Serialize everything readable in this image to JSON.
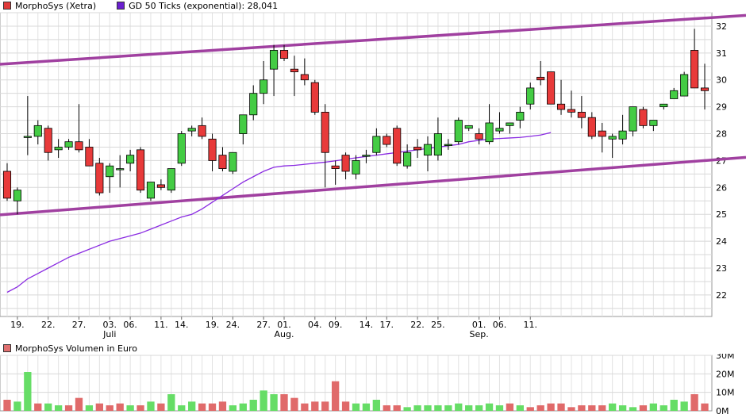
{
  "chart_data": [
    {
      "type": "candlestick",
      "legend": [
        {
          "label": "MorphoSys (Xetra)",
          "color": "#e03a3a"
        },
        {
          "label": "GD 50 Ticks (exponential): 28,041",
          "color": "#6a1fd0"
        }
      ],
      "yticks": [
        22,
        23,
        24,
        25,
        26,
        27,
        28,
        29,
        30,
        31,
        32
      ],
      "ylim": [
        21.2,
        32.5
      ],
      "x_ticks": [
        {
          "i": 1,
          "label": "19."
        },
        {
          "i": 4,
          "label": "22."
        },
        {
          "i": 7,
          "label": "27."
        },
        {
          "i": 10,
          "label": "03.",
          "sub": "Juli"
        },
        {
          "i": 12,
          "label": "06."
        },
        {
          "i": 15,
          "label": "11."
        },
        {
          "i": 17,
          "label": "14."
        },
        {
          "i": 20,
          "label": "19."
        },
        {
          "i": 22,
          "label": "24."
        },
        {
          "i": 25,
          "label": "27."
        },
        {
          "i": 27,
          "label": "01.",
          "sub": "Aug."
        },
        {
          "i": 30,
          "label": "04."
        },
        {
          "i": 32,
          "label": "09."
        },
        {
          "i": 35,
          "label": "14."
        },
        {
          "i": 37,
          "label": "17."
        },
        {
          "i": 40,
          "label": "22."
        },
        {
          "i": 42,
          "label": "25."
        },
        {
          "i": 46,
          "label": "01.",
          "sub": "Sep."
        },
        {
          "i": 48,
          "label": "06."
        },
        {
          "i": 51,
          "label": "11."
        }
      ],
      "ohlc": [
        [
          26.6,
          26.9,
          25.5,
          25.6
        ],
        [
          25.5,
          26.0,
          25.0,
          25.9
        ],
        [
          27.9,
          29.4,
          27.2,
          27.9
        ],
        [
          27.9,
          28.5,
          27.6,
          28.3
        ],
        [
          28.2,
          28.3,
          27.0,
          27.3
        ],
        [
          27.4,
          27.8,
          27.1,
          27.5
        ],
        [
          27.5,
          27.8,
          27.4,
          27.7
        ],
        [
          27.7,
          29.1,
          27.3,
          27.4
        ],
        [
          27.5,
          27.8,
          26.8,
          26.8
        ],
        [
          26.9,
          27.1,
          25.7,
          25.8
        ],
        [
          26.4,
          26.9,
          25.8,
          26.8
        ],
        [
          26.7,
          27.2,
          26.0,
          26.7
        ],
        [
          26.9,
          27.4,
          26.6,
          27.2
        ],
        [
          27.4,
          27.5,
          25.8,
          25.9
        ],
        [
          25.6,
          26.2,
          25.5,
          26.2
        ],
        [
          26.1,
          26.3,
          25.9,
          26.0
        ],
        [
          25.9,
          26.7,
          25.8,
          26.7
        ],
        [
          26.9,
          28.1,
          26.8,
          28.0
        ],
        [
          28.1,
          28.3,
          27.9,
          28.2
        ],
        [
          28.3,
          28.6,
          27.8,
          27.9
        ],
        [
          27.8,
          28.0,
          26.6,
          27.0
        ],
        [
          27.2,
          27.5,
          26.6,
          26.7
        ],
        [
          26.6,
          27.3,
          26.5,
          27.3
        ],
        [
          28.0,
          28.7,
          27.6,
          28.7
        ],
        [
          28.7,
          29.8,
          28.5,
          29.5
        ],
        [
          29.5,
          30.7,
          29.1,
          30.0
        ],
        [
          30.4,
          31.3,
          29.4,
          31.1
        ],
        [
          31.1,
          31.3,
          30.7,
          30.8
        ],
        [
          30.4,
          30.9,
          29.4,
          30.3
        ],
        [
          30.2,
          30.8,
          29.8,
          30.0
        ],
        [
          29.9,
          30.0,
          28.7,
          28.8
        ],
        [
          28.8,
          29.1,
          26.0,
          27.3
        ],
        [
          26.8,
          27.0,
          26.1,
          26.7
        ],
        [
          27.2,
          27.3,
          26.3,
          26.6
        ],
        [
          26.5,
          27.2,
          26.3,
          27.0
        ],
        [
          27.2,
          27.4,
          26.9,
          27.2
        ],
        [
          27.3,
          28.2,
          27.2,
          27.9
        ],
        [
          27.9,
          28.0,
          27.5,
          27.6
        ],
        [
          28.2,
          28.3,
          26.8,
          26.9
        ],
        [
          26.8,
          27.6,
          26.7,
          27.3
        ],
        [
          27.5,
          27.8,
          27.1,
          27.4
        ],
        [
          27.2,
          27.9,
          26.6,
          27.6
        ],
        [
          27.2,
          28.6,
          27.0,
          28.0
        ],
        [
          27.6,
          27.8,
          27.4,
          27.6
        ],
        [
          27.7,
          28.6,
          27.6,
          28.5
        ],
        [
          28.2,
          28.3,
          28.1,
          28.3
        ],
        [
          28.0,
          28.2,
          27.6,
          27.8
        ],
        [
          27.7,
          29.1,
          27.6,
          28.4
        ],
        [
          28.1,
          28.8,
          28.0,
          28.2
        ],
        [
          28.3,
          28.4,
          28.0,
          28.4
        ],
        [
          28.5,
          29.0,
          28.2,
          28.8
        ],
        [
          29.1,
          29.9,
          28.9,
          29.7
        ],
        [
          30.1,
          30.7,
          29.8,
          30.0
        ],
        [
          30.3,
          30.3,
          29.1,
          29.1
        ],
        [
          29.1,
          30.0,
          28.7,
          28.9
        ],
        [
          28.9,
          29.6,
          28.6,
          28.8
        ],
        [
          28.8,
          29.4,
          28.2,
          28.6
        ],
        [
          28.6,
          28.8,
          27.8,
          27.9
        ],
        [
          28.1,
          28.4,
          27.3,
          27.9
        ],
        [
          27.8,
          28.0,
          27.1,
          27.9
        ],
        [
          27.8,
          28.7,
          27.6,
          28.1
        ],
        [
          28.1,
          29.0,
          27.9,
          29.0
        ],
        [
          28.9,
          29.0,
          28.2,
          28.3
        ],
        [
          28.3,
          28.5,
          28.1,
          28.5
        ],
        [
          29.0,
          29.1,
          28.9,
          29.1
        ],
        [
          29.3,
          29.7,
          29.3,
          29.6
        ],
        [
          29.4,
          30.3,
          29.4,
          30.2
        ],
        [
          31.1,
          31.9,
          29.7,
          29.7
        ],
        [
          29.7,
          30.6,
          28.9,
          29.6
        ]
      ],
      "gd50": [
        22.1,
        22.3,
        22.6,
        22.8,
        23.0,
        23.2,
        23.4,
        23.55,
        23.7,
        23.85,
        24.0,
        24.1,
        24.2,
        24.3,
        24.45,
        24.6,
        24.75,
        24.9,
        25.0,
        25.2,
        25.45,
        25.7,
        25.95,
        26.2,
        26.4,
        26.6,
        26.75,
        26.8,
        26.82,
        26.86,
        26.9,
        26.94,
        26.99,
        27.05,
        27.1,
        27.15,
        27.2,
        27.25,
        27.3,
        27.35,
        27.4,
        27.45,
        27.5,
        27.55,
        27.6,
        27.7,
        27.75,
        27.8,
        27.82,
        27.84,
        27.86,
        27.9,
        27.95,
        28.04
      ],
      "channel": {
        "upper": [
          [
            0,
            30.6
          ],
          [
            68,
            32.3
          ]
        ],
        "lower": [
          [
            0,
            25.0
          ],
          [
            68,
            27.0
          ]
        ]
      }
    },
    {
      "type": "bar",
      "legend": [
        {
          "label": "MorphoSys Volumen in Euro",
          "color": "#e07070"
        }
      ],
      "yticks": [
        "30M",
        "20M",
        "10M",
        "0M"
      ],
      "ylim": [
        0,
        30
      ],
      "volumes_m": [
        6,
        5,
        21,
        4,
        4,
        3,
        3,
        7,
        3,
        4,
        3,
        4,
        3,
        3,
        5,
        4,
        9,
        3,
        5,
        4,
        4,
        5,
        3,
        4,
        6,
        11,
        9,
        9,
        7,
        4,
        5,
        5,
        16,
        5,
        4,
        4,
        6,
        3,
        3,
        2,
        3,
        3,
        3,
        3,
        4,
        3,
        3,
        4,
        3,
        4,
        3,
        2,
        3,
        4,
        4,
        2,
        3,
        3,
        3,
        4,
        3,
        2,
        3,
        4,
        3,
        6,
        5,
        9,
        4
      ],
      "volume_up": [
        false,
        true,
        true,
        false,
        true,
        true,
        false,
        false,
        true,
        false,
        false,
        false,
        true,
        false,
        true,
        false,
        true,
        true,
        true,
        false,
        false,
        false,
        true,
        true,
        true,
        true,
        true,
        false,
        false,
        false,
        false,
        false,
        false,
        false,
        true,
        true,
        true,
        false,
        false,
        true,
        true,
        true,
        true,
        true,
        true,
        true,
        true,
        true,
        true,
        false,
        true,
        false,
        false,
        false,
        false,
        false,
        false,
        false,
        false,
        true,
        true,
        true,
        false,
        true,
        true,
        true,
        true,
        false,
        false
      ]
    }
  ]
}
